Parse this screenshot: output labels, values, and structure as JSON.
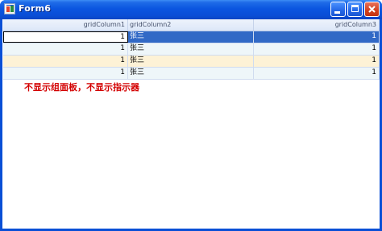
{
  "window": {
    "title": "Form6",
    "icon": "form-icon",
    "controls": {
      "minimize": "minimize-icon",
      "maximize": "maximize-icon",
      "close": "close-icon"
    }
  },
  "grid": {
    "columns": [
      "gridColumn1",
      "gridColumn2",
      "gridColumn3"
    ],
    "rows": [
      [
        "1",
        "张三",
        "1"
      ],
      [
        "1",
        "张三",
        "1"
      ],
      [
        "1",
        "张三",
        "1"
      ],
      [
        "1",
        "张三",
        "1"
      ]
    ]
  },
  "note": "不显示组面板，不显示指示器",
  "colors": {
    "titlebar": "#0a4fd6",
    "selection": "#3169c6",
    "row_alt": "#fdf2d6",
    "note": "#d30000"
  }
}
